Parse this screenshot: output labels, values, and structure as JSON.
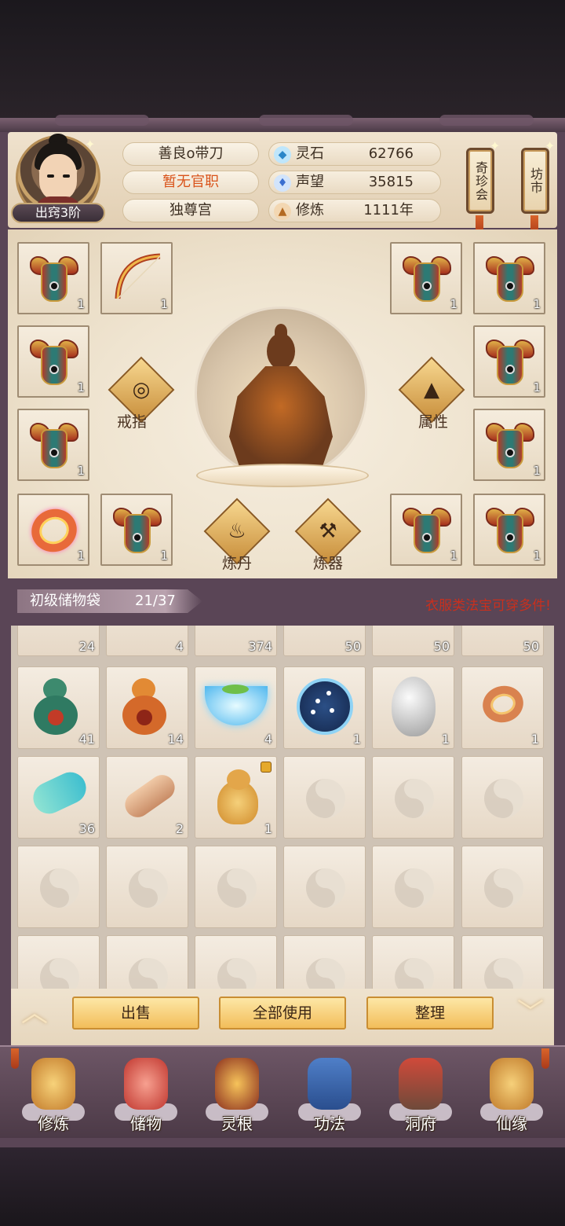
{
  "player": {
    "rank_badge": "出窍3阶",
    "name": "善良o带刀",
    "official_title": "暂无官职",
    "sect": "独尊宫"
  },
  "stats": [
    {
      "label": "灵石",
      "value": "62766",
      "icon": "spirit-stone-icon",
      "color": "#3aa0e0"
    },
    {
      "label": "声望",
      "value": "35815",
      "icon": "prestige-crystal-icon",
      "color": "#4a8de0"
    },
    {
      "label": "修炼",
      "value": "1111年",
      "icon": "meditation-icon",
      "color": "#d08a3a"
    }
  ],
  "right_buttons": [
    {
      "label": "奇珍会"
    },
    {
      "label": "坊市"
    }
  ],
  "equipment": {
    "slots": [
      {
        "item": "armor-icon",
        "count": "1"
      },
      {
        "item": "bow-icon",
        "count": "1"
      },
      {
        "item": "armor-icon",
        "count": "1"
      },
      {
        "item": "armor-icon",
        "count": "1"
      },
      {
        "item": "armor-icon",
        "count": "1"
      },
      {
        "item": "armor-icon",
        "count": "1"
      },
      {
        "item": "armor-icon",
        "count": "1"
      },
      {
        "item": "armor-icon",
        "count": "1"
      },
      {
        "item": "ring-icon",
        "count": "1"
      },
      {
        "item": "armor-icon",
        "count": "1"
      },
      {
        "item": "armor-icon",
        "count": "1"
      },
      {
        "item": "armor-icon",
        "count": "1"
      }
    ],
    "buttons": {
      "ring": "戒指",
      "attributes": "属性",
      "alchemy": "炼丹",
      "forging": "炼器"
    }
  },
  "bag": {
    "title": "初级储物袋",
    "count": "21/37",
    "tip": "衣服类法宝可穿多件!",
    "rows": [
      [
        {
          "item": "root-herb-icon",
          "count": "24"
        },
        {
          "item": "green-herb-icon",
          "count": "4"
        },
        {
          "item": "centipede-icon",
          "count": "374"
        },
        {
          "item": "green-ore-icon",
          "count": "50"
        },
        {
          "item": "purple-ore-icon",
          "count": "50"
        },
        {
          "item": "dark-ore-icon",
          "count": "50"
        }
      ],
      [
        {
          "item": "green-gourd-icon",
          "count": "41"
        },
        {
          "item": "orange-gourd-icon",
          "count": "14"
        },
        {
          "item": "spirit-bowl-icon",
          "count": "4"
        },
        {
          "item": "star-disc-icon",
          "count": "1"
        },
        {
          "item": "silver-egg-icon",
          "count": "1"
        },
        {
          "item": "ring-icon",
          "count": "1"
        }
      ],
      [
        {
          "item": "jade-cloud-icon",
          "count": "36"
        },
        {
          "item": "scroll-icon",
          "count": "2"
        },
        {
          "item": "golden-rat-icon",
          "count": "1",
          "locked": true
        },
        {
          "item": "empty",
          "count": ""
        },
        {
          "item": "empty",
          "count": ""
        },
        {
          "item": "empty",
          "count": ""
        }
      ],
      [
        {
          "item": "empty",
          "count": ""
        },
        {
          "item": "empty",
          "count": ""
        },
        {
          "item": "empty",
          "count": ""
        },
        {
          "item": "empty",
          "count": ""
        },
        {
          "item": "empty",
          "count": ""
        },
        {
          "item": "empty",
          "count": ""
        }
      ],
      [
        {
          "item": "empty",
          "count": ""
        },
        {
          "item": "empty",
          "count": ""
        },
        {
          "item": "empty",
          "count": ""
        },
        {
          "item": "empty",
          "count": ""
        },
        {
          "item": "empty",
          "count": ""
        },
        {
          "item": "empty",
          "count": ""
        }
      ]
    ]
  },
  "actions": {
    "sell": "出售",
    "use_all": "全部使用",
    "organize": "整理"
  },
  "nav": [
    {
      "label": "修炼",
      "icon": "cultivator-icon"
    },
    {
      "label": "储物",
      "icon": "storage-bag-icon"
    },
    {
      "label": "灵根",
      "icon": "spirit-root-icon"
    },
    {
      "label": "功法",
      "icon": "manual-book-icon"
    },
    {
      "label": "洞府",
      "icon": "cave-mansion-icon"
    },
    {
      "label": "仙缘",
      "icon": "gourd-fate-icon"
    }
  ]
}
